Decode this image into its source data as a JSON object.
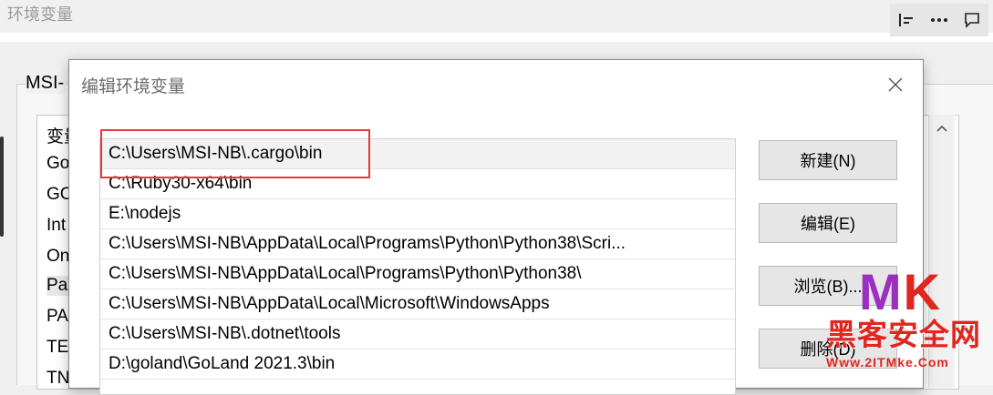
{
  "background": {
    "window_title": "环境变量",
    "group_label": "MSI-",
    "list_items": [
      "变量",
      "Go",
      "GC",
      "Int",
      "On",
      "Pa",
      "PA",
      "TE",
      "TN"
    ]
  },
  "toolbar": {
    "icons": [
      "align-left-icon",
      "more-icon",
      "comment-icon"
    ]
  },
  "dialog": {
    "title": "编辑环境变量",
    "close_icon": "close-icon",
    "paths": [
      "C:\\Users\\MSI-NB\\.cargo\\bin",
      "C:\\Ruby30-x64\\bin",
      "E:\\nodejs",
      "C:\\Users\\MSI-NB\\AppData\\Local\\Programs\\Python\\Python38\\Scri...",
      "C:\\Users\\MSI-NB\\AppData\\Local\\Programs\\Python\\Python38\\",
      "C:\\Users\\MSI-NB\\AppData\\Local\\Microsoft\\WindowsApps",
      "C:\\Users\\MSI-NB\\.dotnet\\tools",
      "D:\\goland\\GoLand 2021.3\\bin"
    ],
    "selected_index": 0,
    "buttons": {
      "new": "新建(N)",
      "edit": "编辑(E)",
      "browse": "浏览(B)...",
      "delete": "删除(D)"
    }
  },
  "watermark": {
    "logo_m": "M",
    "logo_k": "K",
    "text_cn": "黑客安全网",
    "url": "Www.2ITMke.Com"
  }
}
